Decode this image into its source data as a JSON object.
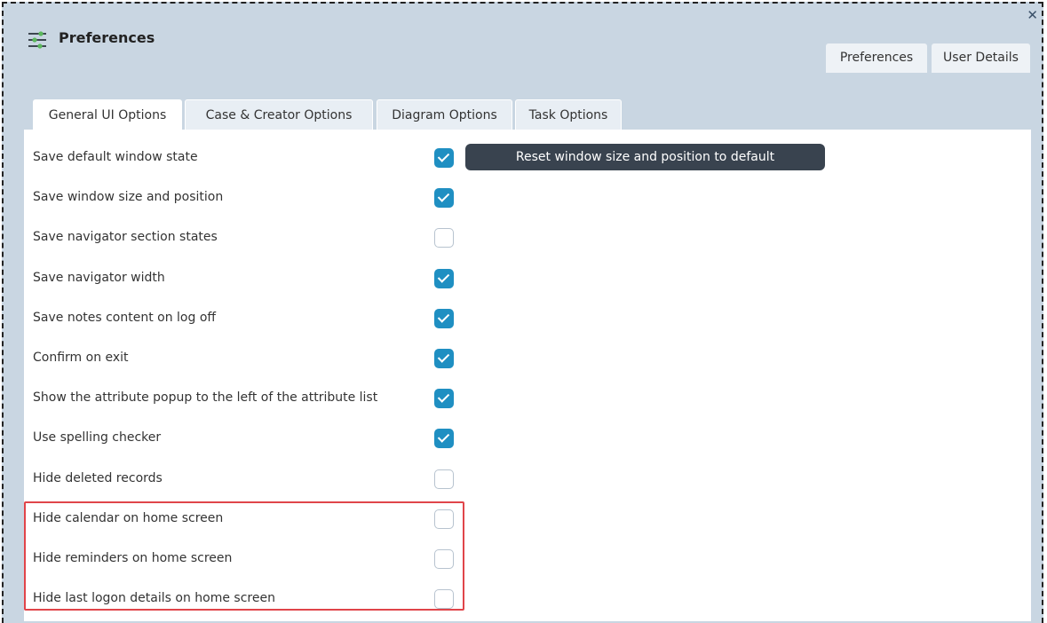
{
  "window": {
    "title": "Preferences",
    "close_glyph": "✕",
    "title_icon": "sliders-icon"
  },
  "outer_tabs": [
    {
      "label": "Preferences"
    },
    {
      "label": "User Details"
    }
  ],
  "inner_tabs": [
    {
      "label": "General UI Options",
      "active": true
    },
    {
      "label": "Case & Creator Options",
      "active": false
    },
    {
      "label": "Diagram Options",
      "active": false
    },
    {
      "label": "Task Options",
      "active": false
    }
  ],
  "reset_button": {
    "label": "Reset window size and position to default"
  },
  "options": [
    {
      "label": "Save default window state",
      "checked": true
    },
    {
      "label": "Save window size and position",
      "checked": true
    },
    {
      "label": "Save navigator section states",
      "checked": false
    },
    {
      "label": "Save navigator width",
      "checked": true
    },
    {
      "label": "Save notes content on log off",
      "checked": true
    },
    {
      "label": "Confirm on exit",
      "checked": true
    },
    {
      "label": "Show the attribute popup to the left of the attribute list",
      "checked": true
    },
    {
      "label": "Use spelling checker",
      "checked": true
    },
    {
      "label": "Hide deleted records",
      "checked": false
    },
    {
      "label": "Hide calendar on home screen",
      "checked": false
    },
    {
      "label": "Hide reminders on home screen",
      "checked": false
    },
    {
      "label": "Hide last logon details on home screen",
      "checked": false
    }
  ],
  "colors": {
    "accent": "#1f8fc2",
    "header_bg": "#c9d6e2",
    "button_bg": "#39434f",
    "highlight_border": "#e0454a"
  }
}
